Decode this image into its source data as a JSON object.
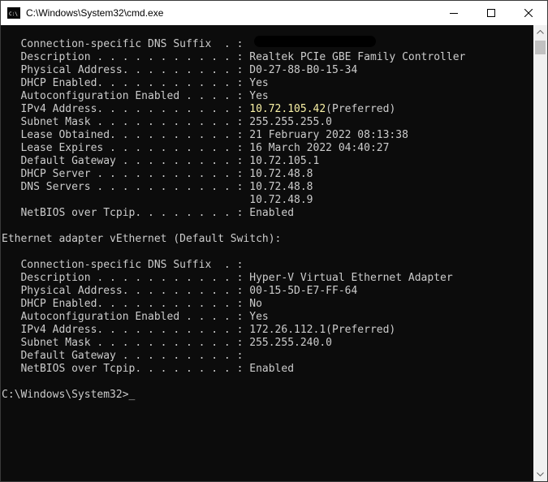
{
  "window": {
    "title": "C:\\Windows\\System32\\cmd.exe",
    "app_icon": "cmd-icon",
    "controls": [
      "minimize-icon",
      "maximize-icon",
      "close-icon"
    ]
  },
  "console": {
    "text_color": "#cccccc",
    "highlight_color": "#f9f1a5",
    "background": "#0c0c0c",
    "lines": [
      "",
      "   Connection-specific DNS Suffix  . : ",
      "   Description . . . . . . . . . . . : Realtek PCIe GBE Family Controller",
      "   Physical Address. . . . . . . . . : D0-27-88-B0-15-34",
      "   DHCP Enabled. . . . . . . . . . . : Yes",
      "   Autoconfiguration Enabled . . . . : Yes",
      "   IPv4 Address. . . . . . . . . . . : ",
      "   Subnet Mask . . . . . . . . . . . : 255.255.255.0",
      "   Lease Obtained. . . . . . . . . . : 21 February 2022 08:13:38",
      "   Lease Expires . . . . . . . . . . : 16 March 2022 04:40:27",
      "   Default Gateway . . . . . . . . . : 10.72.105.1",
      "   DHCP Server . . . . . . . . . . . : 10.72.48.8",
      "   DNS Servers . . . . . . . . . . . : 10.72.48.8",
      "                                       10.72.48.9",
      "   NetBIOS over Tcpip. . . . . . . . : Enabled",
      "",
      "Ethernet adapter vEthernet (Default Switch):",
      "",
      "   Connection-specific DNS Suffix  . :",
      "   Description . . . . . . . . . . . : Hyper-V Virtual Ethernet Adapter",
      "   Physical Address. . . . . . . . . : 00-15-5D-E7-FF-64",
      "   DHCP Enabled. . . . . . . . . . . : No",
      "   Autoconfiguration Enabled . . . . : Yes",
      "   IPv4 Address. . . . . . . . . . . : 172.26.112.1(Preferred)",
      "   Subnet Mask . . . . . . . . . . . : 255.255.240.0",
      "   Default Gateway . . . . . . . . . :",
      "   NetBIOS over Tcpip. . . . . . . . : Enabled",
      "",
      "C:\\Windows\\System32>_"
    ],
    "highlighted_ip": "10.72.105.42",
    "highlighted_ip_suffix": "(Preferred)"
  },
  "scrollbar": {
    "up_icon": "scroll-up-arrow-icon",
    "down_icon": "scroll-down-arrow-icon"
  }
}
